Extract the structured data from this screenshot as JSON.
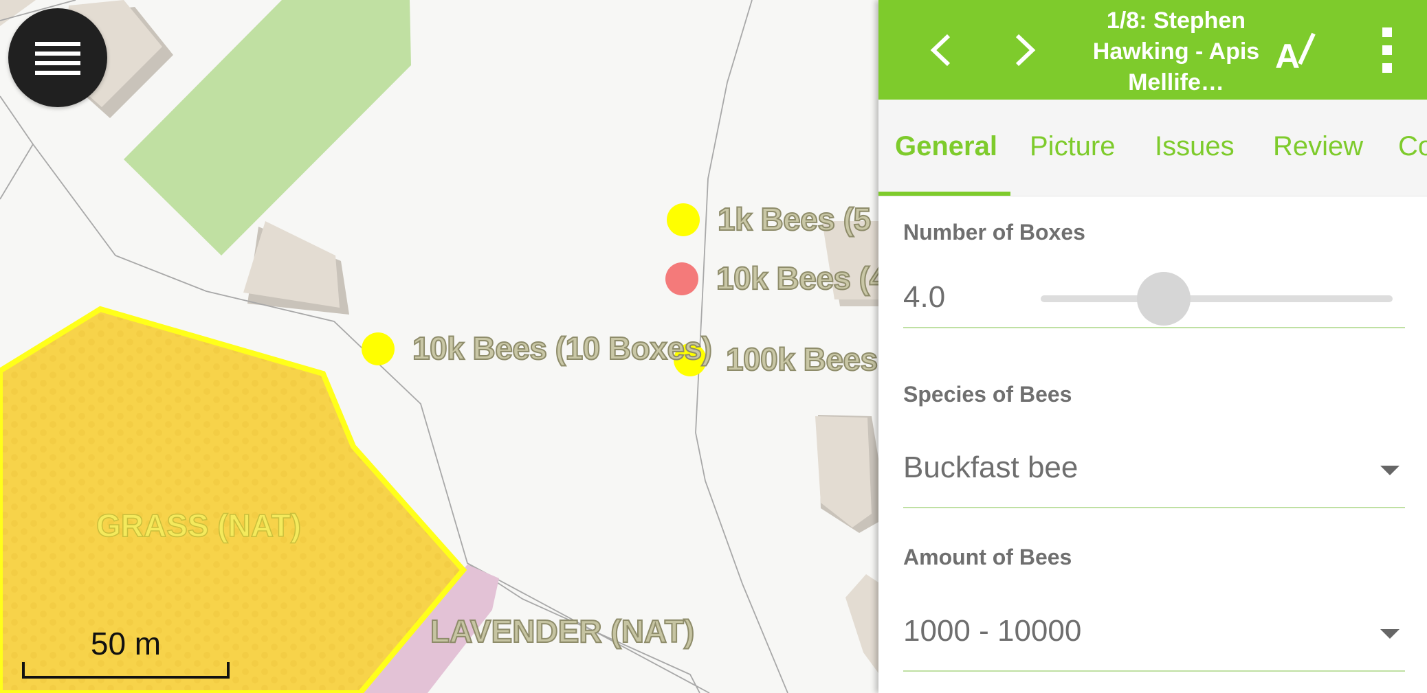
{
  "map": {
    "menu_icon": "hamburger-menu-icon",
    "labels": {
      "bees_1k": "1k Bees (5",
      "bees_10k_red": "10k Bees (4",
      "bees_10k_left": "10k Bees (10 Boxes)",
      "bees_100k": "100k Bees"
    },
    "areas": {
      "grass": "GRASS (NAT)",
      "lavender": "LAVENDER (NAT)"
    },
    "scale": "50 m",
    "colors": {
      "hive_yellow": "#ffff00",
      "hive_red": "#f47a7a",
      "grass_fill": "#f7d34a",
      "grass_border": "#ffff1a",
      "park_green": "#c0e0a2",
      "building": "#e3dcd2",
      "lavender": "#e3c2d6"
    }
  },
  "panel": {
    "toolbar": {
      "title": "1/8: Stephen Hawking - Apis Mellife…",
      "prev_icon": "chevron-left-icon",
      "next_icon": "chevron-right-icon",
      "edit_icon": "text-edit-icon",
      "more_icon": "more-vert-icon",
      "color": "#7ecb2c"
    },
    "tabs": [
      {
        "label": "General",
        "active": true
      },
      {
        "label": "Picture"
      },
      {
        "label": "Issues"
      },
      {
        "label": "Review"
      },
      {
        "label": "Co"
      }
    ],
    "fields": {
      "boxes": {
        "label": "Number of Boxes",
        "value": "4.0",
        "slider_fraction": 0.35
      },
      "species": {
        "label": "Species of Bees",
        "value": "Buckfast bee"
      },
      "amount": {
        "label": "Amount of Bees",
        "value": "1000 - 10000"
      }
    }
  }
}
